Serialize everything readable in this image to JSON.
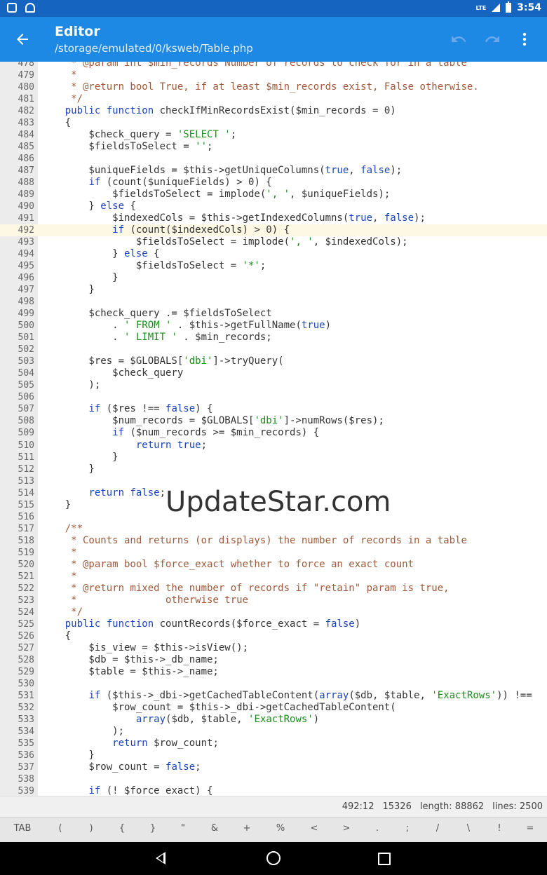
{
  "statusbar": {
    "time": "3:54",
    "network": "LTE"
  },
  "toolbar": {
    "title": "Editor",
    "path": "/storage/emulated/0/ksweb/Table.php",
    "icons": [
      "back-arrow-icon",
      "undo-icon",
      "redo-icon",
      "more-vert-icon"
    ]
  },
  "editor": {
    "current_line": 492,
    "lines": [
      {
        "n": "478",
        "segs": [
          {
            "t": "     * @param int $min_records Number of records to check for in a table",
            "c": "cm"
          }
        ]
      },
      {
        "n": "479",
        "segs": [
          {
            "t": "     *",
            "c": "cm"
          }
        ]
      },
      {
        "n": "480",
        "segs": [
          {
            "t": "     * @return bool True, if at least $min_records exist, False otherwise.",
            "c": "cm"
          }
        ]
      },
      {
        "n": "481",
        "segs": [
          {
            "t": "     */",
            "c": "cm"
          }
        ]
      },
      {
        "n": "482",
        "segs": [
          {
            "t": "    ",
            "c": ""
          },
          {
            "t": "public function",
            "c": "kw"
          },
          {
            "t": " checkIfMinRecordsExist($min_records = 0)",
            "c": ""
          }
        ]
      },
      {
        "n": "483",
        "segs": [
          {
            "t": "    {",
            "c": ""
          }
        ]
      },
      {
        "n": "484",
        "segs": [
          {
            "t": "        $check_query = ",
            "c": ""
          },
          {
            "t": "'SELECT '",
            "c": "str"
          },
          {
            "t": ";",
            "c": ""
          }
        ]
      },
      {
        "n": "485",
        "segs": [
          {
            "t": "        $fieldsToSelect = ",
            "c": ""
          },
          {
            "t": "''",
            "c": "str"
          },
          {
            "t": ";",
            "c": ""
          }
        ]
      },
      {
        "n": "486",
        "segs": [
          {
            "t": "",
            "c": ""
          }
        ]
      },
      {
        "n": "487",
        "segs": [
          {
            "t": "        $uniqueFields = $this->getUniqueColumns(",
            "c": ""
          },
          {
            "t": "true",
            "c": "kw"
          },
          {
            "t": ", ",
            "c": ""
          },
          {
            "t": "false",
            "c": "kw"
          },
          {
            "t": ");",
            "c": ""
          }
        ]
      },
      {
        "n": "488",
        "segs": [
          {
            "t": "        ",
            "c": ""
          },
          {
            "t": "if",
            "c": "kw"
          },
          {
            "t": " (count($uniqueFields) > 0) {",
            "c": ""
          }
        ]
      },
      {
        "n": "489",
        "segs": [
          {
            "t": "            $fieldsToSelect = implode(",
            "c": ""
          },
          {
            "t": "', '",
            "c": "str"
          },
          {
            "t": ", $uniqueFields);",
            "c": ""
          }
        ]
      },
      {
        "n": "490",
        "segs": [
          {
            "t": "        } ",
            "c": ""
          },
          {
            "t": "else",
            "c": "kw"
          },
          {
            "t": " {",
            "c": ""
          }
        ]
      },
      {
        "n": "491",
        "segs": [
          {
            "t": "            $indexedCols = $this->getIndexedColumns(",
            "c": ""
          },
          {
            "t": "true",
            "c": "kw"
          },
          {
            "t": ", ",
            "c": ""
          },
          {
            "t": "false",
            "c": "kw"
          },
          {
            "t": ");",
            "c": ""
          }
        ]
      },
      {
        "n": "492",
        "segs": [
          {
            "t": "            ",
            "c": ""
          },
          {
            "t": "if",
            "c": "kw"
          },
          {
            "t": " (count($indexedCols) > 0) {",
            "c": ""
          }
        ]
      },
      {
        "n": "493",
        "segs": [
          {
            "t": "                $fieldsToSelect = implode(",
            "c": ""
          },
          {
            "t": "', '",
            "c": "str"
          },
          {
            "t": ", $indexedCols);",
            "c": ""
          }
        ]
      },
      {
        "n": "494",
        "segs": [
          {
            "t": "            } ",
            "c": ""
          },
          {
            "t": "else",
            "c": "kw"
          },
          {
            "t": " {",
            "c": ""
          }
        ]
      },
      {
        "n": "495",
        "segs": [
          {
            "t": "                $fieldsToSelect = ",
            "c": ""
          },
          {
            "t": "'*'",
            "c": "str"
          },
          {
            "t": ";",
            "c": ""
          }
        ]
      },
      {
        "n": "496",
        "segs": [
          {
            "t": "            }",
            "c": ""
          }
        ]
      },
      {
        "n": "497",
        "segs": [
          {
            "t": "        }",
            "c": ""
          }
        ]
      },
      {
        "n": "498",
        "segs": [
          {
            "t": "",
            "c": ""
          }
        ]
      },
      {
        "n": "499",
        "segs": [
          {
            "t": "        $check_query .= $fieldsToSelect",
            "c": ""
          }
        ]
      },
      {
        "n": "500",
        "segs": [
          {
            "t": "            . ",
            "c": ""
          },
          {
            "t": "' FROM '",
            "c": "str"
          },
          {
            "t": " . $this->getFullName(",
            "c": ""
          },
          {
            "t": "true",
            "c": "kw"
          },
          {
            "t": ")",
            "c": ""
          }
        ]
      },
      {
        "n": "501",
        "segs": [
          {
            "t": "            . ",
            "c": ""
          },
          {
            "t": "' LIMIT '",
            "c": "str"
          },
          {
            "t": " . $min_records;",
            "c": ""
          }
        ]
      },
      {
        "n": "502",
        "segs": [
          {
            "t": "",
            "c": ""
          }
        ]
      },
      {
        "n": "503",
        "segs": [
          {
            "t": "        $res = $GLOBALS[",
            "c": ""
          },
          {
            "t": "'dbi'",
            "c": "str"
          },
          {
            "t": "]->tryQuery(",
            "c": ""
          }
        ]
      },
      {
        "n": "504",
        "segs": [
          {
            "t": "            $check_query",
            "c": ""
          }
        ]
      },
      {
        "n": "505",
        "segs": [
          {
            "t": "        );",
            "c": ""
          }
        ]
      },
      {
        "n": "506",
        "segs": [
          {
            "t": "",
            "c": ""
          }
        ]
      },
      {
        "n": "507",
        "segs": [
          {
            "t": "        ",
            "c": ""
          },
          {
            "t": "if",
            "c": "kw"
          },
          {
            "t": " ($res !== ",
            "c": ""
          },
          {
            "t": "false",
            "c": "kw"
          },
          {
            "t": ") {",
            "c": ""
          }
        ]
      },
      {
        "n": "508",
        "segs": [
          {
            "t": "            $num_records = $GLOBALS[",
            "c": ""
          },
          {
            "t": "'dbi'",
            "c": "str"
          },
          {
            "t": "]->numRows($res);",
            "c": ""
          }
        ]
      },
      {
        "n": "509",
        "segs": [
          {
            "t": "            ",
            "c": ""
          },
          {
            "t": "if",
            "c": "kw"
          },
          {
            "t": " ($num_records >= $min_records) {",
            "c": ""
          }
        ]
      },
      {
        "n": "510",
        "segs": [
          {
            "t": "                ",
            "c": ""
          },
          {
            "t": "return true",
            "c": "kw"
          },
          {
            "t": ";",
            "c": ""
          }
        ]
      },
      {
        "n": "511",
        "segs": [
          {
            "t": "            }",
            "c": ""
          }
        ]
      },
      {
        "n": "512",
        "segs": [
          {
            "t": "        }",
            "c": ""
          }
        ]
      },
      {
        "n": "513",
        "segs": [
          {
            "t": "",
            "c": ""
          }
        ]
      },
      {
        "n": "514",
        "segs": [
          {
            "t": "        ",
            "c": ""
          },
          {
            "t": "return false",
            "c": "kw"
          },
          {
            "t": ";",
            "c": ""
          }
        ]
      },
      {
        "n": "515",
        "segs": [
          {
            "t": "    }",
            "c": ""
          }
        ]
      },
      {
        "n": "516",
        "segs": [
          {
            "t": "",
            "c": ""
          }
        ]
      },
      {
        "n": "517",
        "segs": [
          {
            "t": "    /**",
            "c": "cm"
          }
        ]
      },
      {
        "n": "518",
        "segs": [
          {
            "t": "     * Counts and returns (or displays) the number of records in a table",
            "c": "cm"
          }
        ]
      },
      {
        "n": "519",
        "segs": [
          {
            "t": "     *",
            "c": "cm"
          }
        ]
      },
      {
        "n": "520",
        "segs": [
          {
            "t": "     * @param bool $force_exact whether to force an exact count",
            "c": "cm"
          }
        ]
      },
      {
        "n": "521",
        "segs": [
          {
            "t": "     *",
            "c": "cm"
          }
        ]
      },
      {
        "n": "522",
        "segs": [
          {
            "t": "     * @return mixed the number of records if \"retain\" param is true,",
            "c": "cm"
          }
        ]
      },
      {
        "n": "523",
        "segs": [
          {
            "t": "     *               otherwise true",
            "c": "cm"
          }
        ]
      },
      {
        "n": "524",
        "segs": [
          {
            "t": "     */",
            "c": "cm"
          }
        ]
      },
      {
        "n": "525",
        "segs": [
          {
            "t": "    ",
            "c": ""
          },
          {
            "t": "public function",
            "c": "kw"
          },
          {
            "t": " countRecords($force_exact = ",
            "c": ""
          },
          {
            "t": "false",
            "c": "kw"
          },
          {
            "t": ")",
            "c": ""
          }
        ]
      },
      {
        "n": "526",
        "segs": [
          {
            "t": "    {",
            "c": ""
          }
        ]
      },
      {
        "n": "527",
        "segs": [
          {
            "t": "        $is_view = $this->isView();",
            "c": ""
          }
        ]
      },
      {
        "n": "528",
        "segs": [
          {
            "t": "        $db = $this->_db_name;",
            "c": ""
          }
        ]
      },
      {
        "n": "529",
        "segs": [
          {
            "t": "        $table = $this->_name;",
            "c": ""
          }
        ]
      },
      {
        "n": "530",
        "segs": [
          {
            "t": "",
            "c": ""
          }
        ]
      },
      {
        "n": "531",
        "segs": [
          {
            "t": "        ",
            "c": ""
          },
          {
            "t": "if",
            "c": "kw"
          },
          {
            "t": " ($this->_dbi->getCachedTableContent(",
            "c": ""
          },
          {
            "t": "array",
            "c": "kw"
          },
          {
            "t": "($db, $table, ",
            "c": ""
          },
          {
            "t": "'ExactRows'",
            "c": "str"
          },
          {
            "t": ")) !==",
            "c": ""
          }
        ]
      },
      {
        "n": "532",
        "segs": [
          {
            "t": "            $row_count = $this->_dbi->getCachedTableContent(",
            "c": ""
          }
        ]
      },
      {
        "n": "533",
        "segs": [
          {
            "t": "                ",
            "c": ""
          },
          {
            "t": "array",
            "c": "kw"
          },
          {
            "t": "($db, $table, ",
            "c": ""
          },
          {
            "t": "'ExactRows'",
            "c": "str"
          },
          {
            "t": ")",
            "c": ""
          }
        ]
      },
      {
        "n": "534",
        "segs": [
          {
            "t": "            );",
            "c": ""
          }
        ]
      },
      {
        "n": "535",
        "segs": [
          {
            "t": "            ",
            "c": ""
          },
          {
            "t": "return",
            "c": "kw"
          },
          {
            "t": " $row_count;",
            "c": ""
          }
        ]
      },
      {
        "n": "536",
        "segs": [
          {
            "t": "        }",
            "c": ""
          }
        ]
      },
      {
        "n": "537",
        "segs": [
          {
            "t": "        $row_count = ",
            "c": ""
          },
          {
            "t": "false",
            "c": "kw"
          },
          {
            "t": ";",
            "c": ""
          }
        ]
      },
      {
        "n": "538",
        "segs": [
          {
            "t": "",
            "c": ""
          }
        ]
      },
      {
        "n": "539",
        "segs": [
          {
            "t": "        ",
            "c": ""
          },
          {
            "t": "if",
            "c": "kw"
          },
          {
            "t": " (! $force_exact) {",
            "c": ""
          }
        ]
      }
    ]
  },
  "watermark": "UpdateStar.com",
  "infobar": {
    "position": "492:12",
    "offset": "15326",
    "length": "length: 88862",
    "lines": "lines: 2500"
  },
  "keys": [
    "TAB",
    "(",
    ")",
    "{",
    "}",
    "\"",
    "&",
    "+",
    "%",
    "<",
    ">",
    ".",
    ";",
    "/",
    "\\",
    "!",
    "="
  ],
  "navbar": {
    "icons": [
      "nav-back-icon",
      "nav-home-icon",
      "nav-recents-icon"
    ]
  }
}
